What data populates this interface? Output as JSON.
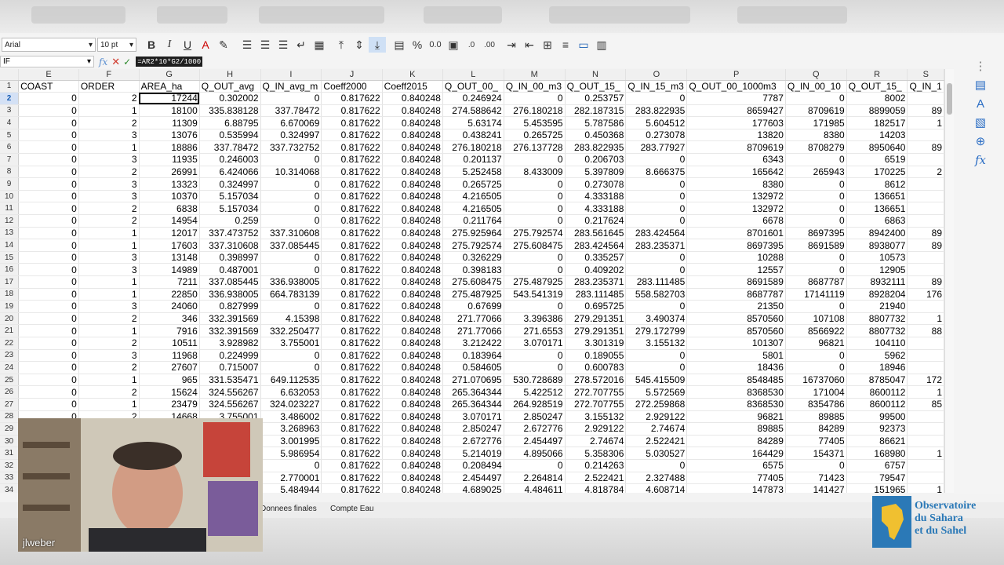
{
  "toolbar": {
    "font_name": "Arial",
    "font_size": "10 pt",
    "bold_label": "B",
    "italic_label": "I",
    "underline_label": "U",
    "percent_label": "%",
    "decimal_label": "0.0"
  },
  "formula": {
    "name_box": "IF",
    "value": "=AR2*10*G2/1000"
  },
  "columns": [
    {
      "col": "E",
      "header": "COAST"
    },
    {
      "col": "F",
      "header": "ORDER"
    },
    {
      "col": "G",
      "header": "AREA_ha"
    },
    {
      "col": "H",
      "header": "Q_OUT_avg"
    },
    {
      "col": "I",
      "header": "Q_IN_avg_m"
    },
    {
      "col": "J",
      "header": "Coeff2000"
    },
    {
      "col": "K",
      "header": "Coeff2015"
    },
    {
      "col": "L",
      "header": "Q_OUT_00_"
    },
    {
      "col": "M",
      "header": "Q_IN_00_m3"
    },
    {
      "col": "N",
      "header": "Q_OUT_15_"
    },
    {
      "col": "O",
      "header": "Q_IN_15_m3"
    },
    {
      "col": "P",
      "header": "Q_OUT_00_1000m3"
    },
    {
      "col": "Q",
      "header": "Q_IN_00_10"
    },
    {
      "col": "R",
      "header": "Q_OUT_15_"
    },
    {
      "col": "S",
      "header": "Q_IN_1"
    }
  ],
  "rows": [
    {
      "n": "2",
      "cells": [
        "0",
        "2",
        "17244",
        "0.302002",
        "0",
        "0.817622",
        "0.840248",
        "0.246924",
        "0",
        "0.253757",
        "0",
        "7787",
        "0",
        "8002",
        ""
      ]
    },
    {
      "n": "3",
      "cells": [
        "0",
        "1",
        "18100",
        "335.838128",
        "337.78472",
        "0.817622",
        "0.840248",
        "274.588642",
        "276.180218",
        "282.187315",
        "283.822935",
        "8659427",
        "8709619",
        "8899059",
        "89"
      ]
    },
    {
      "n": "4",
      "cells": [
        "0",
        "2",
        "11309",
        "6.88795",
        "6.670069",
        "0.817622",
        "0.840248",
        "5.63174",
        "5.453595",
        "5.787586",
        "5.604512",
        "177603",
        "171985",
        "182517",
        "1"
      ]
    },
    {
      "n": "5",
      "cells": [
        "0",
        "3",
        "13076",
        "0.535994",
        "0.324997",
        "0.817622",
        "0.840248",
        "0.438241",
        "0.265725",
        "0.450368",
        "0.273078",
        "13820",
        "8380",
        "14203",
        ""
      ]
    },
    {
      "n": "6",
      "cells": [
        "0",
        "1",
        "18886",
        "337.78472",
        "337.732752",
        "0.817622",
        "0.840248",
        "276.180218",
        "276.137728",
        "283.822935",
        "283.77927",
        "8709619",
        "8708279",
        "8950640",
        "89"
      ]
    },
    {
      "n": "7",
      "cells": [
        "0",
        "3",
        "11935",
        "0.246003",
        "0",
        "0.817622",
        "0.840248",
        "0.201137",
        "0",
        "0.206703",
        "0",
        "6343",
        "0",
        "6519",
        ""
      ]
    },
    {
      "n": "8",
      "cells": [
        "0",
        "2",
        "26991",
        "6.424066",
        "10.314068",
        "0.817622",
        "0.840248",
        "5.252458",
        "8.433009",
        "5.397809",
        "8.666375",
        "165642",
        "265943",
        "170225",
        "2"
      ]
    },
    {
      "n": "9",
      "cells": [
        "0",
        "3",
        "13323",
        "0.324997",
        "0",
        "0.817622",
        "0.840248",
        "0.265725",
        "0",
        "0.273078",
        "0",
        "8380",
        "0",
        "8612",
        ""
      ]
    },
    {
      "n": "10",
      "cells": [
        "0",
        "3",
        "10370",
        "5.157034",
        "0",
        "0.817622",
        "0.840248",
        "4.216505",
        "0",
        "4.333188",
        "0",
        "132972",
        "0",
        "136651",
        ""
      ]
    },
    {
      "n": "11",
      "cells": [
        "0",
        "2",
        "6838",
        "5.157034",
        "0",
        "0.817622",
        "0.840248",
        "4.216505",
        "0",
        "4.333188",
        "0",
        "132972",
        "0",
        "136651",
        ""
      ]
    },
    {
      "n": "12",
      "cells": [
        "0",
        "2",
        "14954",
        "0.259",
        "0",
        "0.817622",
        "0.840248",
        "0.211764",
        "0",
        "0.217624",
        "0",
        "6678",
        "0",
        "6863",
        ""
      ]
    },
    {
      "n": "13",
      "cells": [
        "0",
        "1",
        "12017",
        "337.473752",
        "337.310608",
        "0.817622",
        "0.840248",
        "275.925964",
        "275.792574",
        "283.561645",
        "283.424564",
        "8701601",
        "8697395",
        "8942400",
        "89"
      ]
    },
    {
      "n": "14",
      "cells": [
        "0",
        "1",
        "17603",
        "337.310608",
        "337.085445",
        "0.817622",
        "0.840248",
        "275.792574",
        "275.608475",
        "283.424564",
        "283.235371",
        "8697395",
        "8691589",
        "8938077",
        "89"
      ]
    },
    {
      "n": "15",
      "cells": [
        "0",
        "3",
        "13148",
        "0.398997",
        "0",
        "0.817622",
        "0.840248",
        "0.326229",
        "0",
        "0.335257",
        "0",
        "10288",
        "0",
        "10573",
        ""
      ]
    },
    {
      "n": "16",
      "cells": [
        "0",
        "3",
        "14989",
        "0.487001",
        "0",
        "0.817622",
        "0.840248",
        "0.398183",
        "0",
        "0.409202",
        "0",
        "12557",
        "0",
        "12905",
        ""
      ]
    },
    {
      "n": "17",
      "cells": [
        "0",
        "1",
        "7211",
        "337.085445",
        "336.938005",
        "0.817622",
        "0.840248",
        "275.608475",
        "275.487925",
        "283.235371",
        "283.111485",
        "8691589",
        "8687787",
        "8932111",
        "89"
      ]
    },
    {
      "n": "18",
      "cells": [
        "0",
        "1",
        "22850",
        "336.938005",
        "664.783139",
        "0.817622",
        "0.840248",
        "275.487925",
        "543.541319",
        "283.111485",
        "558.582703",
        "8687787",
        "17141119",
        "8928204",
        "176"
      ]
    },
    {
      "n": "19",
      "cells": [
        "0",
        "3",
        "24060",
        "0.827999",
        "0",
        "0.817622",
        "0.840248",
        "0.67699",
        "0",
        "0.695725",
        "0",
        "21350",
        "0",
        "21940",
        ""
      ]
    },
    {
      "n": "20",
      "cells": [
        "0",
        "2",
        "346",
        "332.391569",
        "4.15398",
        "0.817622",
        "0.840248",
        "271.77066",
        "3.396386",
        "279.291351",
        "3.490374",
        "8570560",
        "107108",
        "8807732",
        "1"
      ]
    },
    {
      "n": "21",
      "cells": [
        "0",
        "1",
        "7916",
        "332.391569",
        "332.250477",
        "0.817622",
        "0.840248",
        "271.77066",
        "271.6553",
        "279.291351",
        "279.172799",
        "8570560",
        "8566922",
        "8807732",
        "88"
      ]
    },
    {
      "n": "22",
      "cells": [
        "0",
        "2",
        "10511",
        "3.928982",
        "3.755001",
        "0.817622",
        "0.840248",
        "3.212422",
        "3.070171",
        "3.301319",
        "3.155132",
        "101307",
        "96821",
        "104110",
        ""
      ]
    },
    {
      "n": "23",
      "cells": [
        "0",
        "3",
        "11968",
        "0.224999",
        "0",
        "0.817622",
        "0.840248",
        "0.183964",
        "0",
        "0.189055",
        "0",
        "5801",
        "0",
        "5962",
        ""
      ]
    },
    {
      "n": "24",
      "cells": [
        "0",
        "2",
        "27607",
        "0.715007",
        "0",
        "0.817622",
        "0.840248",
        "0.584605",
        "0",
        "0.600783",
        "0",
        "18436",
        "0",
        "18946",
        ""
      ]
    },
    {
      "n": "25",
      "cells": [
        "0",
        "1",
        "965",
        "331.535471",
        "649.112535",
        "0.817622",
        "0.840248",
        "271.070695",
        "530.728689",
        "278.572016",
        "545.415509",
        "8548485",
        "16737060",
        "8785047",
        "172"
      ]
    },
    {
      "n": "26",
      "cells": [
        "0",
        "2",
        "15624",
        "324.556267",
        "6.632053",
        "0.817622",
        "0.840248",
        "265.364344",
        "5.422512",
        "272.707755",
        "5.572569",
        "8368530",
        "171004",
        "8600112",
        "1"
      ]
    },
    {
      "n": "27",
      "cells": [
        "0",
        "1",
        "23479",
        "324.556267",
        "324.023227",
        "0.817622",
        "0.840248",
        "265.364344",
        "264.928519",
        "272.707755",
        "272.259868",
        "8368530",
        "8354786",
        "8600112",
        "85"
      ]
    },
    {
      "n": "28",
      "cells": [
        "0",
        "2",
        "14668",
        "3.755001",
        "3.486002",
        "0.817622",
        "0.840248",
        "3.070171",
        "2.850247",
        "3.155132",
        "2.929122",
        "96821",
        "89885",
        "99500",
        ""
      ]
    },
    {
      "n": "29",
      "cells": [
        "",
        "",
        "",
        "",
        "3.268963",
        "0.817622",
        "0.840248",
        "2.850247",
        "2.672776",
        "2.929122",
        "2.74674",
        "89885",
        "84289",
        "92373",
        ""
      ]
    },
    {
      "n": "30",
      "cells": [
        "",
        "",
        "",
        "",
        "3.001995",
        "0.817622",
        "0.840248",
        "2.672776",
        "2.454497",
        "2.74674",
        "2.522421",
        "84289",
        "77405",
        "86621",
        ""
      ]
    },
    {
      "n": "31",
      "cells": [
        "",
        "",
        "",
        "",
        "5.986954",
        "0.817622",
        "0.840248",
        "5.214019",
        "4.895066",
        "5.358306",
        "5.030527",
        "164429",
        "154371",
        "168980",
        "1"
      ]
    },
    {
      "n": "32",
      "cells": [
        "",
        "",
        "",
        "",
        "0",
        "0.817622",
        "0.840248",
        "0.208494",
        "0",
        "0.214263",
        "0",
        "6575",
        "0",
        "6757",
        ""
      ]
    },
    {
      "n": "33",
      "cells": [
        "",
        "",
        "",
        "",
        "2.770001",
        "0.817622",
        "0.840248",
        "2.454497",
        "2.264814",
        "2.522421",
        "2.327488",
        "77405",
        "71423",
        "79547",
        ""
      ]
    },
    {
      "n": "34",
      "cells": [
        "",
        "",
        "",
        "",
        "5.484944",
        "0.817622",
        "0.840248",
        "4.689025",
        "4.484611",
        "4.818784",
        "4.608714",
        "147873",
        "141427",
        "151965",
        "1"
      ]
    }
  ],
  "sheet_tabs": [
    "Donnees finales",
    "Compte Eau"
  ],
  "webcam": {
    "name": "jlweber"
  },
  "logo": {
    "line1": "Observatoire",
    "line2": "du Sahara",
    "line3": "et du Sahel"
  }
}
